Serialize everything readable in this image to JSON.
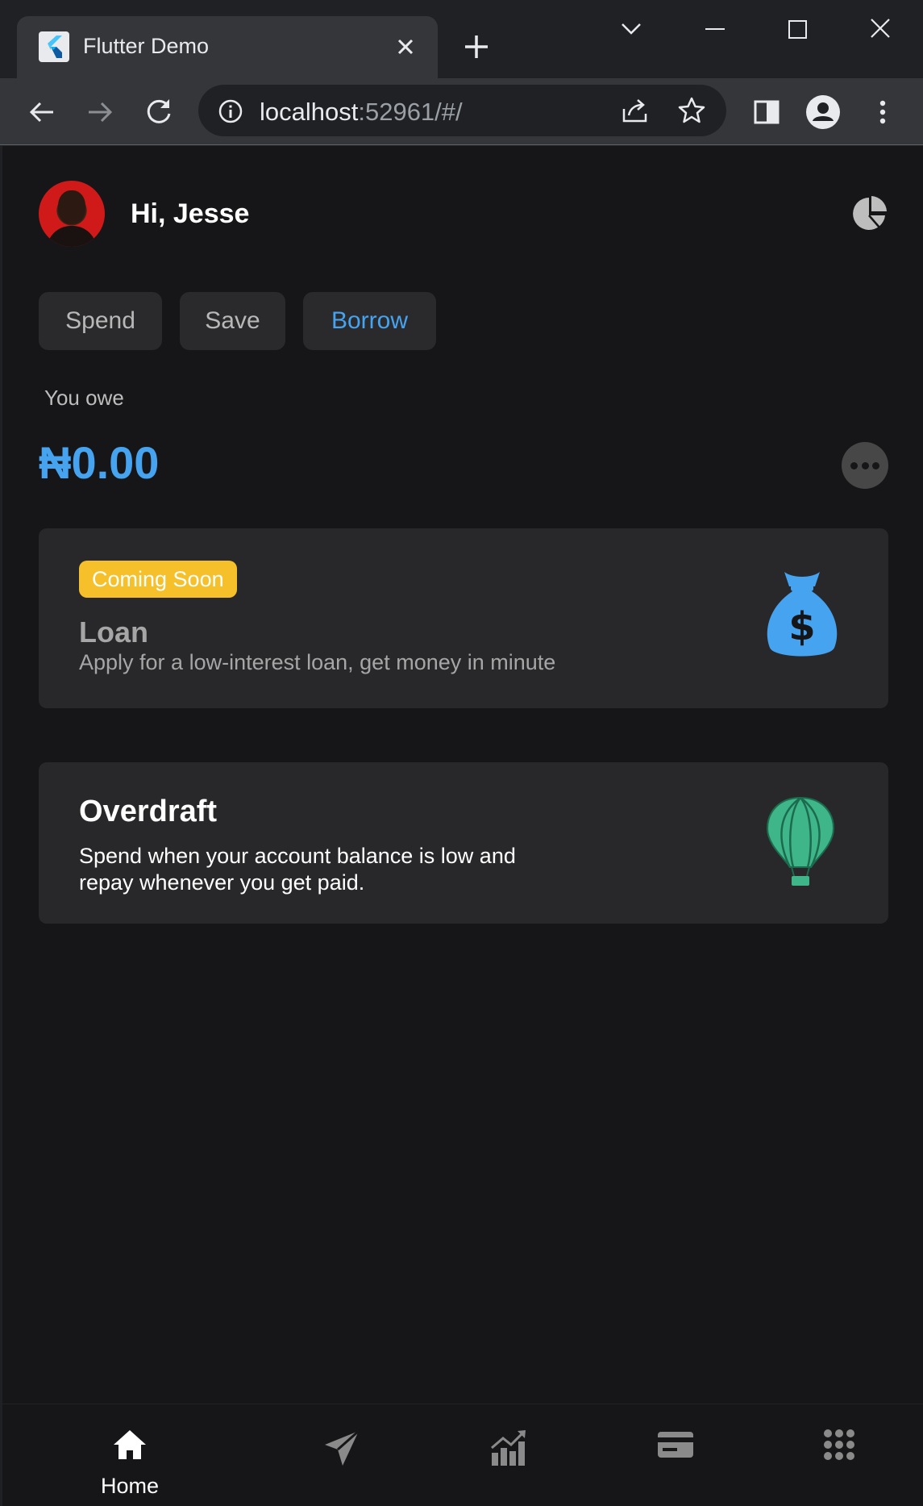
{
  "browser": {
    "tab_title": "Flutter Demo",
    "url_host": "localhost",
    "url_rest": ":52961/#/"
  },
  "header": {
    "greeting": "Hi, Jesse"
  },
  "segments": [
    {
      "label": "Spend",
      "active": false
    },
    {
      "label": "Save",
      "active": false
    },
    {
      "label": "Borrow",
      "active": true
    }
  ],
  "balance": {
    "label": "You owe",
    "amount": "₦0.00"
  },
  "cards": {
    "loan": {
      "badge": "Coming Soon",
      "title": "Loan",
      "description": "Apply for a low-interest loan, get money in minute",
      "icon": "money-bag-icon"
    },
    "overdraft": {
      "title": "Overdraft",
      "description_line1": "Spend when your account balance is low and",
      "description_line2": "repay whenever you get paid.",
      "icon": "hot-air-balloon-icon"
    }
  },
  "bottom_nav": {
    "home_label": "Home",
    "items": [
      "home-icon",
      "send-icon",
      "analytics-icon",
      "card-icon",
      "apps-grid-icon"
    ]
  },
  "colors": {
    "accent": "#45a3f0",
    "badge": "#f5c02a",
    "balloon": "#3fb58a",
    "background": "#161618",
    "card": "#28282a"
  }
}
